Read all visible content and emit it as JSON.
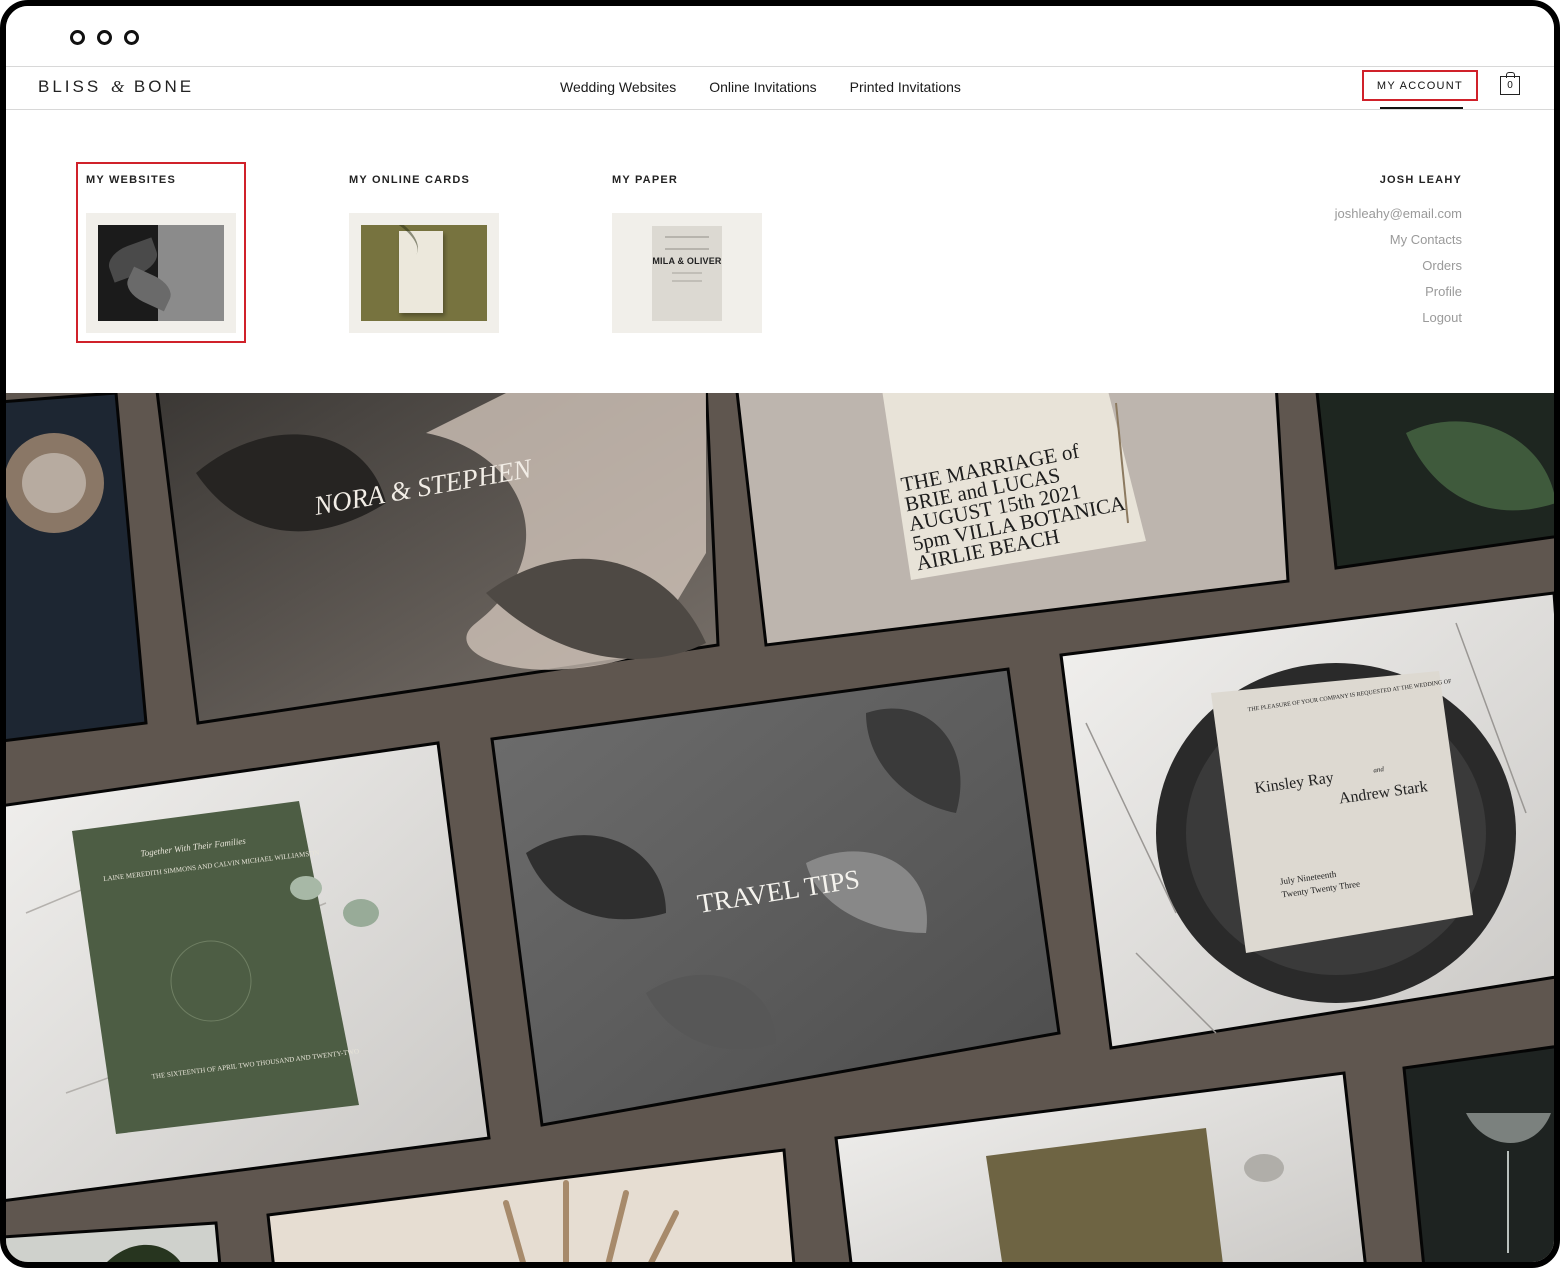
{
  "brand": {
    "logo_part1": "BLISS",
    "logo_amp": "&",
    "logo_part2": "BONE"
  },
  "nav": {
    "links": [
      "Wedding Websites",
      "Online Invitations",
      "Printed Invitations"
    ],
    "account_label": "MY ACCOUNT",
    "cart_count": "0"
  },
  "account_menu": {
    "sections": [
      {
        "title": "MY WEBSITES",
        "thumbnail": "website-preview-leaves"
      },
      {
        "title": "MY ONLINE CARDS",
        "thumbnail": "online-card-preview-olive"
      },
      {
        "title": "MY PAPER",
        "thumbnail": "paper-preview-mila-oliver",
        "card_text": "MILA & OLIVER"
      }
    ],
    "user": {
      "name": "JOSH LEAHY",
      "email": "joshleahy@email.com",
      "links": [
        "My Contacts",
        "Orders",
        "Profile",
        "Logout"
      ]
    }
  },
  "hero": {
    "tiles": {
      "nora": "NORA & STEPHEN",
      "marriage": [
        "THE MARRIAGE of",
        "BRIE and LUCAS",
        "AUGUST 15th 2021",
        "5pm VILLA BOTANICA",
        "AIRLIE BEACH"
      ],
      "travel": "TRAVEL TIPS",
      "kinsley": {
        "lead": "THE PLEASURE OF YOUR COMPANY IS REQUESTED AT THE WEDDING OF",
        "name1": "Kinsley Ray",
        "and": "and",
        "name2": "Andrew Stark",
        "date": "July Nineteenth",
        "year": "Twenty Twenty Three"
      },
      "green_card": {
        "lead": "Together With Their Families",
        "names": "LAINE MEREDITH SIMMONS AND CALVIN MICHAEL WILLIAMSON",
        "date": "THE SIXTEENTH OF APRIL TWO THOUSAND AND TWENTY-TWO"
      }
    }
  },
  "colors": {
    "accent_highlight": "#d0212a",
    "hero_background": "#5f564f",
    "olive": "#77733f",
    "forest": "#4d5d44"
  }
}
